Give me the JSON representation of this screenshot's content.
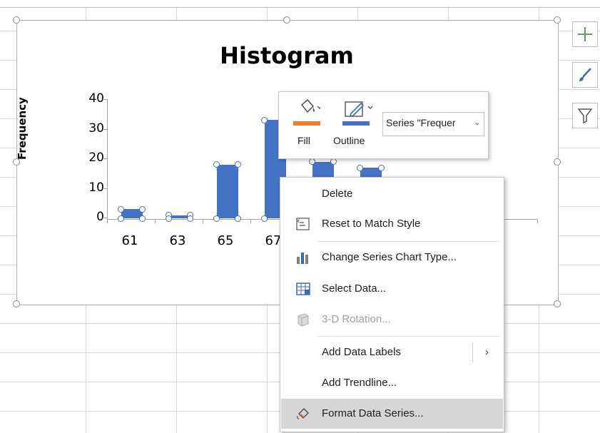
{
  "chart": {
    "title": "Histogram",
    "y_axis_title": "Frequency",
    "y_ticks": [
      "40",
      "30",
      "20",
      "10",
      "0"
    ],
    "x_ticks": [
      "61",
      "63",
      "65",
      "67"
    ]
  },
  "chart_data": {
    "type": "bar",
    "title": "Histogram",
    "ylabel": "Frequency",
    "xlabel": "",
    "ylim": [
      0,
      40
    ],
    "categories": [
      "61",
      "63",
      "65",
      "67",
      "",
      ""
    ],
    "values": [
      3,
      1,
      18,
      33,
      19,
      17
    ]
  },
  "mini_toolbar": {
    "fill_label": "Fill",
    "outline_label": "Outline",
    "series_select_value": "Series \"Frequer",
    "fill_color": "#ed7d31",
    "outline_color": "#4472c4"
  },
  "context_menu": {
    "delete": "Delete",
    "reset_style": "Reset to Match Style",
    "change_chart_type": "Change Series Chart Type...",
    "select_data": "Select Data...",
    "rotation_3d": "3-D Rotation...",
    "add_data_labels": "Add Data Labels",
    "add_trendline": "Add Trendline...",
    "format_series": "Format Data Series..."
  },
  "colors": {
    "series": "#4472c4",
    "hover": "#d6d6d6"
  }
}
